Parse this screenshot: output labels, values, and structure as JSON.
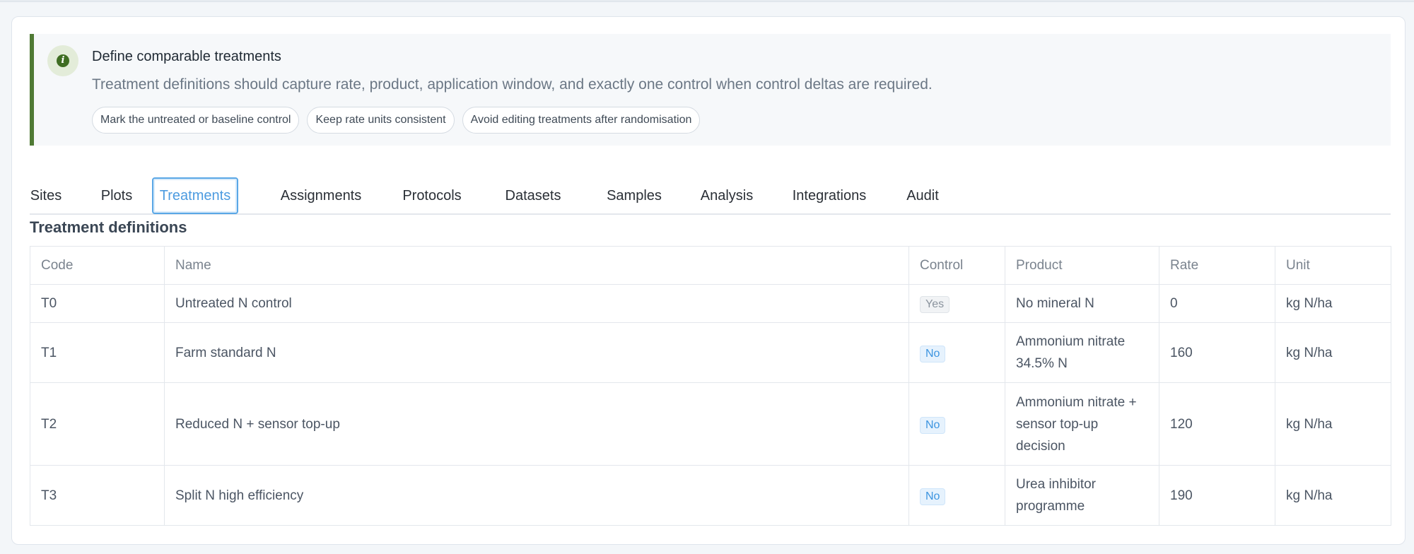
{
  "notice": {
    "icon": "info-icon",
    "accent_color": "#4f7a34",
    "title": "Define comparable treatments",
    "text": "Treatment definitions should capture rate, product, application window, and exactly one control when control deltas are required.",
    "chips": [
      "Mark the untreated or baseline control",
      "Keep rate units consistent",
      "Avoid editing treatments after randomisation"
    ]
  },
  "tabs": [
    {
      "label": "Sites",
      "active": false
    },
    {
      "label": "Plots",
      "active": false
    },
    {
      "label": "Treatments",
      "active": true
    },
    {
      "label": "Assignments",
      "active": false
    },
    {
      "label": "Protocols",
      "active": false
    },
    {
      "label": "Datasets",
      "active": false
    },
    {
      "label": "Samples",
      "active": false
    },
    {
      "label": "Analysis",
      "active": false
    },
    {
      "label": "Integrations",
      "active": false
    },
    {
      "label": "Audit",
      "active": false
    }
  ],
  "section_title": "Treatment definitions",
  "table": {
    "headers": [
      "Code",
      "Name",
      "Control",
      "Product",
      "Rate",
      "Unit"
    ],
    "rows": [
      {
        "code": "T0",
        "name": "Untreated N control",
        "control": "Yes",
        "product": "No mineral N",
        "rate": "0",
        "unit": "kg N/ha"
      },
      {
        "code": "T1",
        "name": "Farm standard N",
        "control": "No",
        "product": "Ammonium nitrate 34.5% N",
        "rate": "160",
        "unit": "kg N/ha"
      },
      {
        "code": "T2",
        "name": "Reduced N + sensor top-up",
        "control": "No",
        "product": "Ammonium nitrate + sensor top-up decision",
        "rate": "120",
        "unit": "kg N/ha"
      },
      {
        "code": "T3",
        "name": "Split N high efficiency",
        "control": "No",
        "product": "Urea inhibitor programme",
        "rate": "190",
        "unit": "kg N/ha"
      }
    ]
  }
}
